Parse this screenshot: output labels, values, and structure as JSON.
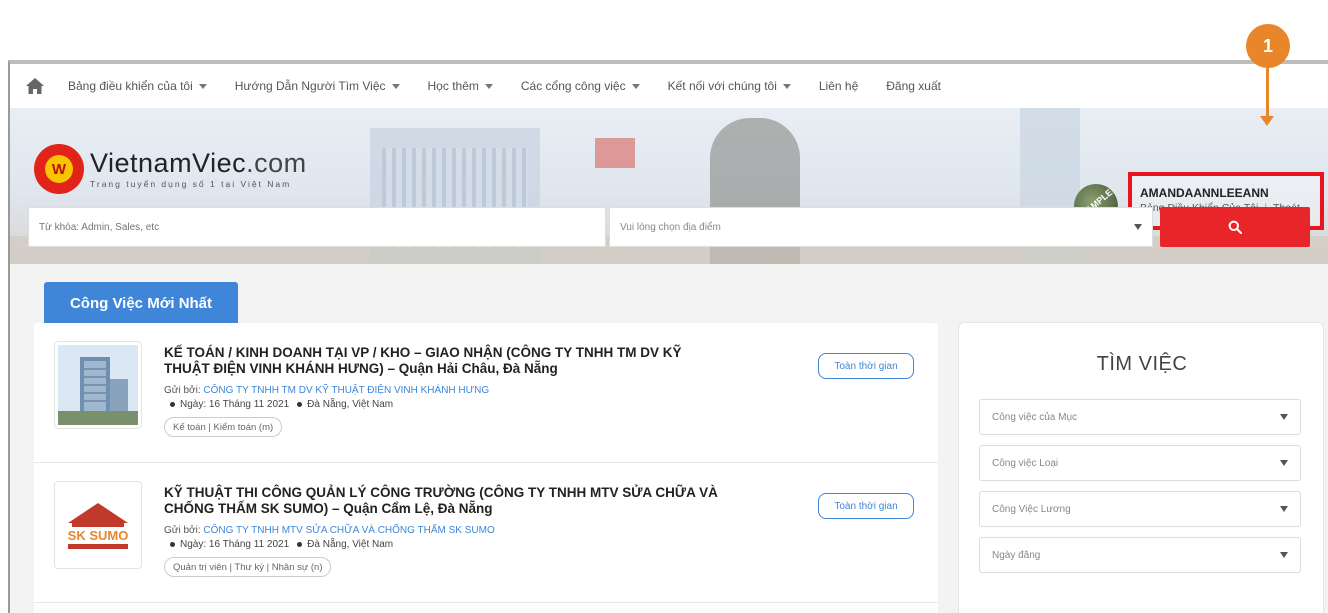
{
  "nav": {
    "home_icon": "home-icon",
    "items": [
      {
        "label": "Bảng điều khiển của tôi",
        "dropdown": true
      },
      {
        "label": "Hướng Dẫn Người Tìm Việc",
        "dropdown": true
      },
      {
        "label": "Học thêm",
        "dropdown": true
      },
      {
        "label": "Các cổng công việc",
        "dropdown": true
      },
      {
        "label": "Kết nối với chúng tôi",
        "dropdown": true
      },
      {
        "label": "Liên hệ",
        "dropdown": false
      },
      {
        "label": "Đăng xuất",
        "dropdown": false
      }
    ]
  },
  "logo": {
    "brand_main": "VietnamViec",
    "brand_suffix": ".com",
    "tagline": "Trang tuyển dụng số 1 tại Việt Nam",
    "mark_letter": "W"
  },
  "user": {
    "avatar_text": "SAMPLE",
    "name": "AMANDAANNLEEANN",
    "dashboard_link": "Bảng Điều Khiển Của Tôi",
    "separator": "|",
    "logout_link": "Thoát"
  },
  "callout": {
    "number": "1",
    "color": "#e8862a"
  },
  "search": {
    "keyword_placeholder": "Từ khóa: Admin, Sales, etc",
    "location_placeholder": "Vui lòng chọn địa điểm",
    "button_icon": "search-icon",
    "button_color": "#e8262a"
  },
  "tab": {
    "label": "Công Việc Mới Nhất",
    "color": "#3f86d9"
  },
  "jobs": [
    {
      "title": "KẾ TOÁN / KINH DOANH TẠI VP / KHO – GIAO NHẬN (CÔNG TY TNHH TM DV KỸ THUẬT ĐIỆN VINH KHÁNH HƯNG) – Quận Hải Châu, Đà Nẵng",
      "posted_by_label": "Gửi bởi:",
      "company": "CÔNG TY TNHH TM DV KỸ THUẬT ĐIỆN VINH KHÁNH HƯNG",
      "date": "Ngày: 16 Tháng 11 2021",
      "location": "Đà Nẵng, Việt Nam",
      "category": "Kế toán | Kiểm toán (m)",
      "type": "Toàn thời gian"
    },
    {
      "title": "KỸ THUẬT THI CÔNG QUẢN LÝ CÔNG TRƯỜNG (CÔNG TY TNHH MTV SỬA CHỮA VÀ CHỐNG THẤM SK SUMO) – Quận Cẩm Lệ, Đà Nẵng",
      "posted_by_label": "Gửi bởi:",
      "company": "CÔNG TY TNHH MTV SỬA CHỮA VÀ CHỐNG THẤM SK SUMO",
      "date": "Ngày: 16 Tháng 11 2021",
      "location": "Đà Nẵng, Việt Nam",
      "category": "Quản trị viên | Thư ký | Nhân sự (n)",
      "type": "Toàn thời gian",
      "logo_text": "SK SUMO"
    }
  ],
  "sidebar": {
    "heading": "TÌM VIỆC",
    "filters": [
      "Công việc của Mục",
      "Công việc Loại",
      "Công Việc Lương",
      "Ngày đăng"
    ]
  }
}
